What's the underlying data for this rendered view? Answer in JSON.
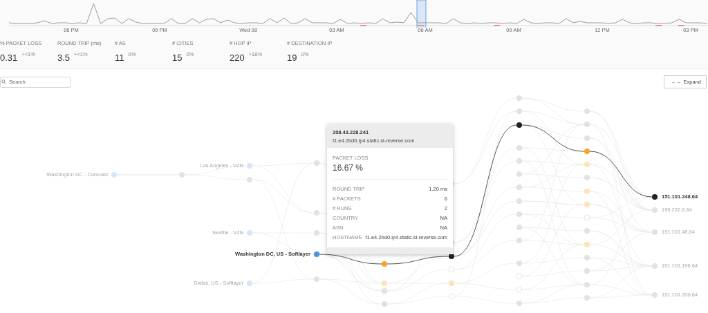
{
  "timeline": {
    "labels": [
      "06 PM",
      "09 PM",
      "Wed 08",
      "03 AM",
      "06 AM",
      "09 AM",
      "12 PM",
      "03 PM"
    ]
  },
  "stats": [
    {
      "label": "% PACKET LOSS",
      "value": "0.31",
      "change": "+<1%"
    },
    {
      "label": "ROUND TRIP (ms)",
      "value": "3.5",
      "change": "+<1%"
    },
    {
      "label": "# AS",
      "value": "11",
      "change": "0%"
    },
    {
      "label": "# CITIES",
      "value": "15",
      "change": "0%"
    },
    {
      "label": "# HOP IP",
      "value": "220",
      "change": "+18%"
    },
    {
      "label": "# DESTINATION IP",
      "value": "19",
      "change": "0%"
    }
  ],
  "search": {
    "placeholder": "Search"
  },
  "expand_button": {
    "label": "Expand",
    "icon": "←→"
  },
  "columns": [
    {
      "nodes": [
        {
          "kind": "source",
          "label": "Washington DC - Comcast",
          "selected": false
        }
      ]
    },
    {
      "nodes": [
        {
          "kind": "idle",
          "selected": false
        }
      ]
    },
    {
      "nodes": [
        {
          "kind": "source",
          "label": "Los Angeles - VZN",
          "selected": false
        },
        {
          "kind": "idle",
          "selected": false
        },
        {
          "kind": "source",
          "label": "Seattle - VZN",
          "selected": false
        },
        {
          "kind": "source",
          "label": "Dallas, US - Softlayer",
          "selected": false
        }
      ]
    },
    {
      "nodes": [
        {
          "kind": "idle",
          "selected": false
        },
        {
          "kind": "idle",
          "selected": false
        },
        {
          "kind": "idle",
          "selected": false
        },
        {
          "kind": "source",
          "label": "Washington DC, US - Softlayer",
          "selected": true
        },
        {
          "kind": "idle",
          "selected": false
        }
      ]
    },
    {
      "nodes": [
        {
          "kind": "loss",
          "selected": true
        },
        {
          "kind": "loss",
          "selected": false
        },
        {
          "kind": "idle",
          "selected": false
        },
        {
          "kind": "idle",
          "selected": false
        }
      ]
    },
    {
      "nodes": [
        {
          "kind": "idle",
          "selected": false
        },
        {
          "kind": "idle",
          "selected": false
        },
        {
          "kind": "idle",
          "selected": true
        },
        {
          "kind": "empty",
          "selected": false
        },
        {
          "kind": "loss",
          "selected": false
        },
        {
          "kind": "empty",
          "selected": false
        }
      ]
    },
    {
      "nodes": [
        {
          "kind": "idle",
          "selected": false
        },
        {
          "kind": "idle",
          "selected": false
        },
        {
          "kind": "idle",
          "selected": true
        },
        {
          "kind": "idle",
          "selected": false
        },
        {
          "kind": "idle",
          "selected": false
        },
        {
          "kind": "idle",
          "selected": false
        },
        {
          "kind": "idle",
          "selected": false
        },
        {
          "kind": "idle",
          "selected": false
        },
        {
          "kind": "idle",
          "selected": false
        },
        {
          "kind": "idle",
          "selected": false
        },
        {
          "kind": "idle",
          "selected": false
        },
        {
          "kind": "idle",
          "selected": false
        },
        {
          "kind": "empty",
          "selected": false
        },
        {
          "kind": "empty",
          "selected": false
        },
        {
          "kind": "idle",
          "selected": false
        }
      ]
    },
    {
      "nodes": [
        {
          "kind": "idle",
          "selected": false
        },
        {
          "kind": "idle",
          "selected": false
        },
        {
          "kind": "idle",
          "selected": false
        },
        {
          "kind": "loss",
          "selected": true
        },
        {
          "kind": "loss",
          "selected": false
        },
        {
          "kind": "idle",
          "selected": false
        },
        {
          "kind": "loss",
          "selected": false
        },
        {
          "kind": "loss",
          "selected": false
        },
        {
          "kind": "empty",
          "selected": false
        },
        {
          "kind": "idle",
          "selected": false
        },
        {
          "kind": "loss",
          "selected": false
        },
        {
          "kind": "idle",
          "selected": false
        },
        {
          "kind": "idle",
          "selected": false
        },
        {
          "kind": "idle",
          "selected": false
        },
        {
          "kind": "idle",
          "selected": false
        }
      ]
    },
    {
      "nodes": [
        {
          "kind": "destination",
          "label": "151.101.248.64",
          "selected": true
        },
        {
          "kind": "destination",
          "label": "199.232.8.64",
          "selected": false
        },
        {
          "kind": "destination",
          "label": "151.101.48.64",
          "selected": false
        },
        {
          "kind": "destination",
          "label": "151.101.196.64",
          "selected": false
        },
        {
          "kind": "destination",
          "label": "151.101.200.64",
          "selected": false
        }
      ]
    }
  ],
  "tooltip": {
    "ip": "208.43.228.241",
    "hostname": "f1.e4.2bd0.ip4.static.sl-reverse.com",
    "metric_label": "PACKET LOSS",
    "metric_value": "16.67 %",
    "rows": [
      {
        "label": "ROUND TRIP",
        "value": "1.20 ms"
      },
      {
        "label": "# PACKETS",
        "value": "6"
      },
      {
        "label": "# RUNS",
        "value": "2"
      },
      {
        "label": "COUNTRY",
        "value": "NA"
      },
      {
        "label": "ASN",
        "value": "NA"
      },
      {
        "label": "HOSTNAME",
        "value": "f1.e4.2bd0.ip4.static.sl-reverse.com"
      }
    ]
  }
}
